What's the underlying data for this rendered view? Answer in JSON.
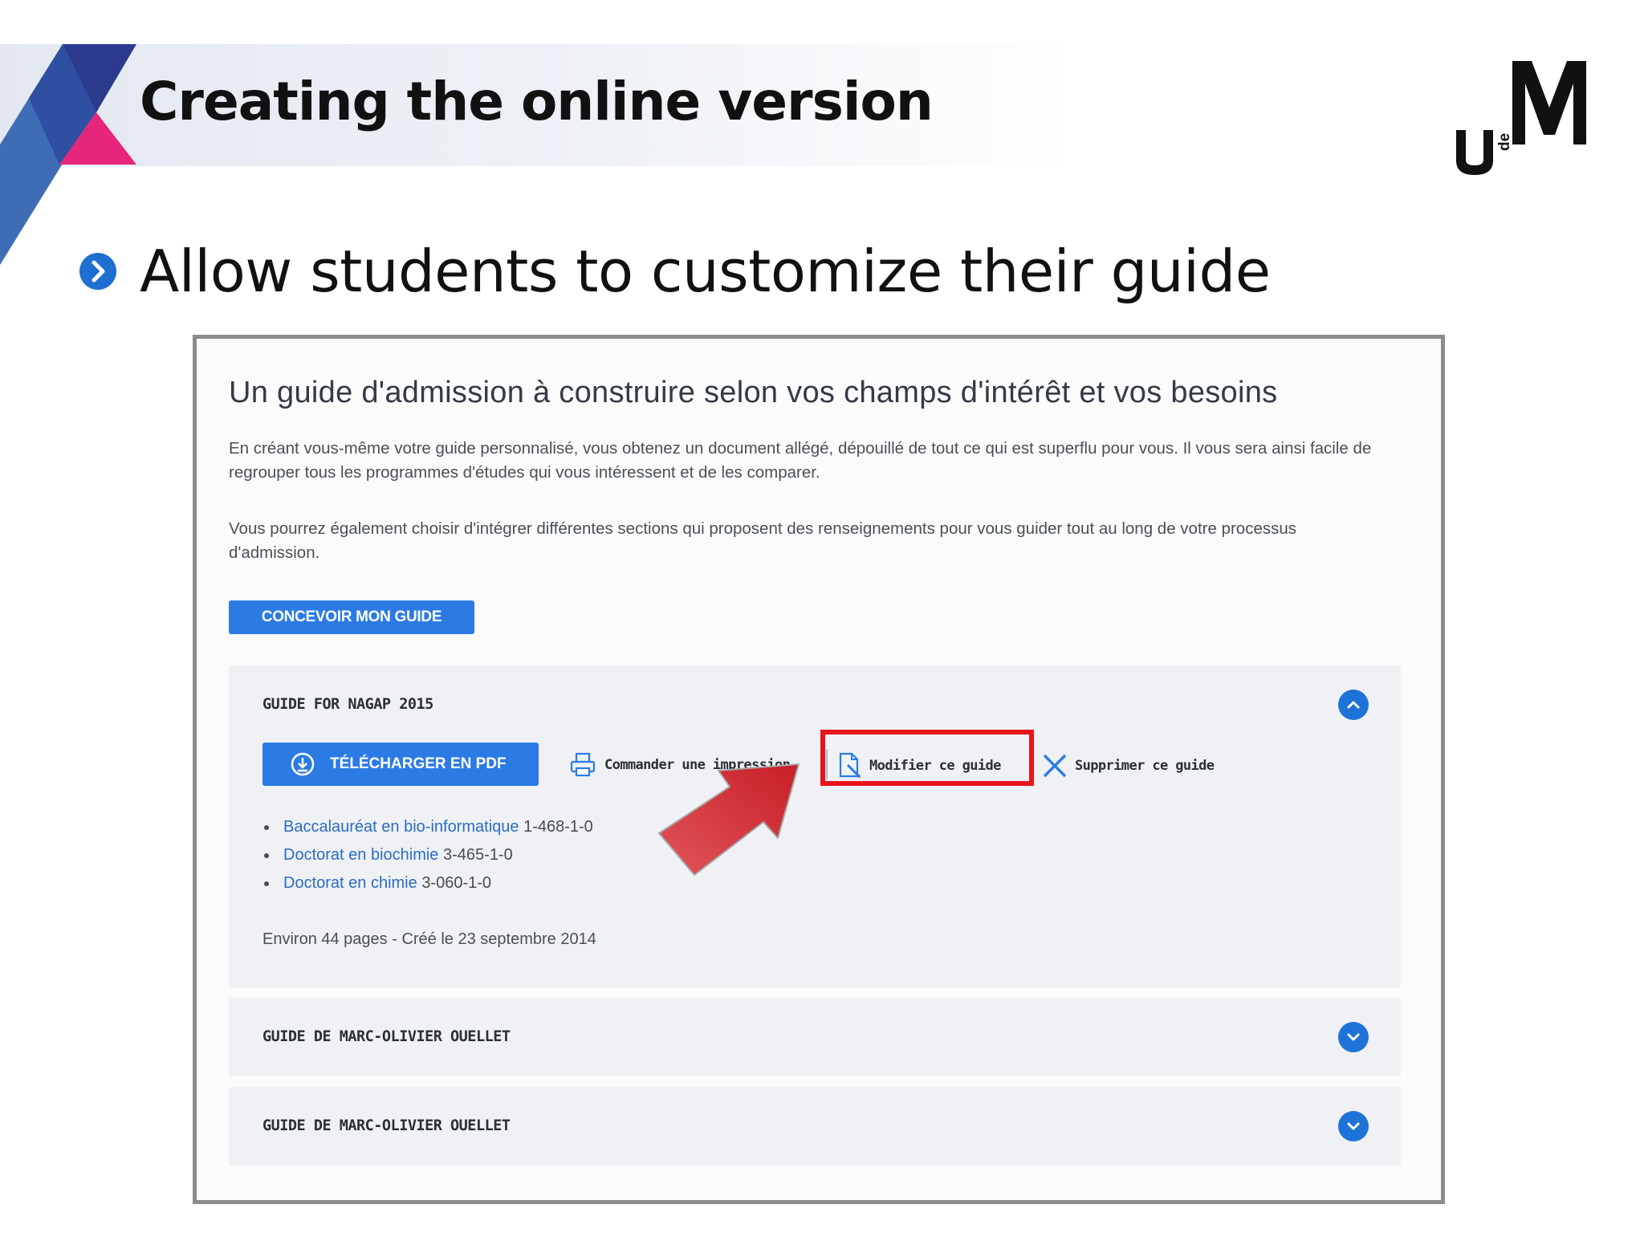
{
  "slide": {
    "title": "Creating the online version",
    "bullet": "Allow students to customize their guide",
    "logo_mark": "UdeM"
  },
  "guide_page": {
    "heading": "Un guide d'admission à construire selon vos champs d'intérêt et vos besoins",
    "paragraph1": "En créant vous-même votre guide personnalisé, vous obtenez un document allégé, dépouillé de tout ce qui est superflu pour vous. Il vous sera ainsi facile de regrouper tous les programmes d'études qui vous intéressent et de les comparer.",
    "paragraph2": "Vous pourrez également choisir d'intégrer différentes sections qui proposent des renseignements pour vous guider tout au long de votre processus d'admission.",
    "design_button": "CONCEVOIR MON GUIDE",
    "guides": [
      {
        "title": "GUIDE FOR NAGAP 2015",
        "expanded": true,
        "download_button": "TÉLÉCHARGER EN PDF",
        "print_action": "Commander une impression",
        "edit_action": "Modifier ce guide",
        "delete_action": "Supprimer ce guide",
        "programs": [
          {
            "name": "Baccalauréat en bio-informatique",
            "code": "1-468-1-0"
          },
          {
            "name": "Doctorat en biochimie",
            "code": "3-465-1-0"
          },
          {
            "name": "Doctorat en chimie",
            "code": "3-060-1-0"
          }
        ],
        "meta": "Environ 44 pages - Créé le 23 septembre 2014"
      },
      {
        "title": "GUIDE DE MARC-OLIVIER OUELLET",
        "expanded": false
      },
      {
        "title": "GUIDE DE MARC-OLIVIER OUELLET",
        "expanded": false
      }
    ]
  },
  "colors": {
    "accent_blue": "#2c7be5",
    "chevron_blue": "#1e73d8",
    "highlight_red": "#e8141b",
    "deco_navy": "#2b3a8c",
    "deco_pink": "#e5267a",
    "deco_blue": "#3f6db5"
  },
  "icons": [
    "bullet-chevron-icon",
    "download-icon",
    "printer-icon",
    "edit-document-icon",
    "close-x-icon",
    "chevron-up-icon",
    "chevron-down-icon",
    "red-arrow-icon"
  ]
}
